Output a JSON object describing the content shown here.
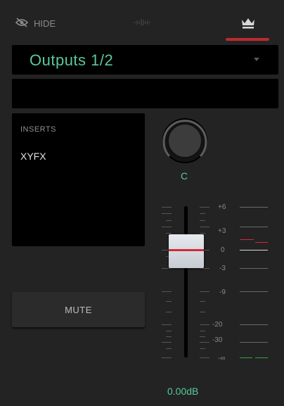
{
  "topbar": {
    "hide_label": "HIDE",
    "hide_icon": "eye-slash-icon",
    "waveform_icon": "waveform-icon",
    "crown_icon": "crown-icon",
    "active_tab_color": "#c0282f"
  },
  "output": {
    "value": "Outputs 1/2",
    "value_color": "#59c99a",
    "caret_icon": "chevron-down-icon"
  },
  "name_field": {
    "value": ""
  },
  "inserts": {
    "title": "INSERTS",
    "slots": [
      "XYFX"
    ]
  },
  "mute": {
    "label": "MUTE"
  },
  "pan": {
    "value": "C"
  },
  "fader": {
    "scale": [
      "+6",
      "+3",
      "0",
      "-3",
      "-9",
      "-20",
      "-30",
      "-∞"
    ],
    "gain": "0.00dB"
  }
}
